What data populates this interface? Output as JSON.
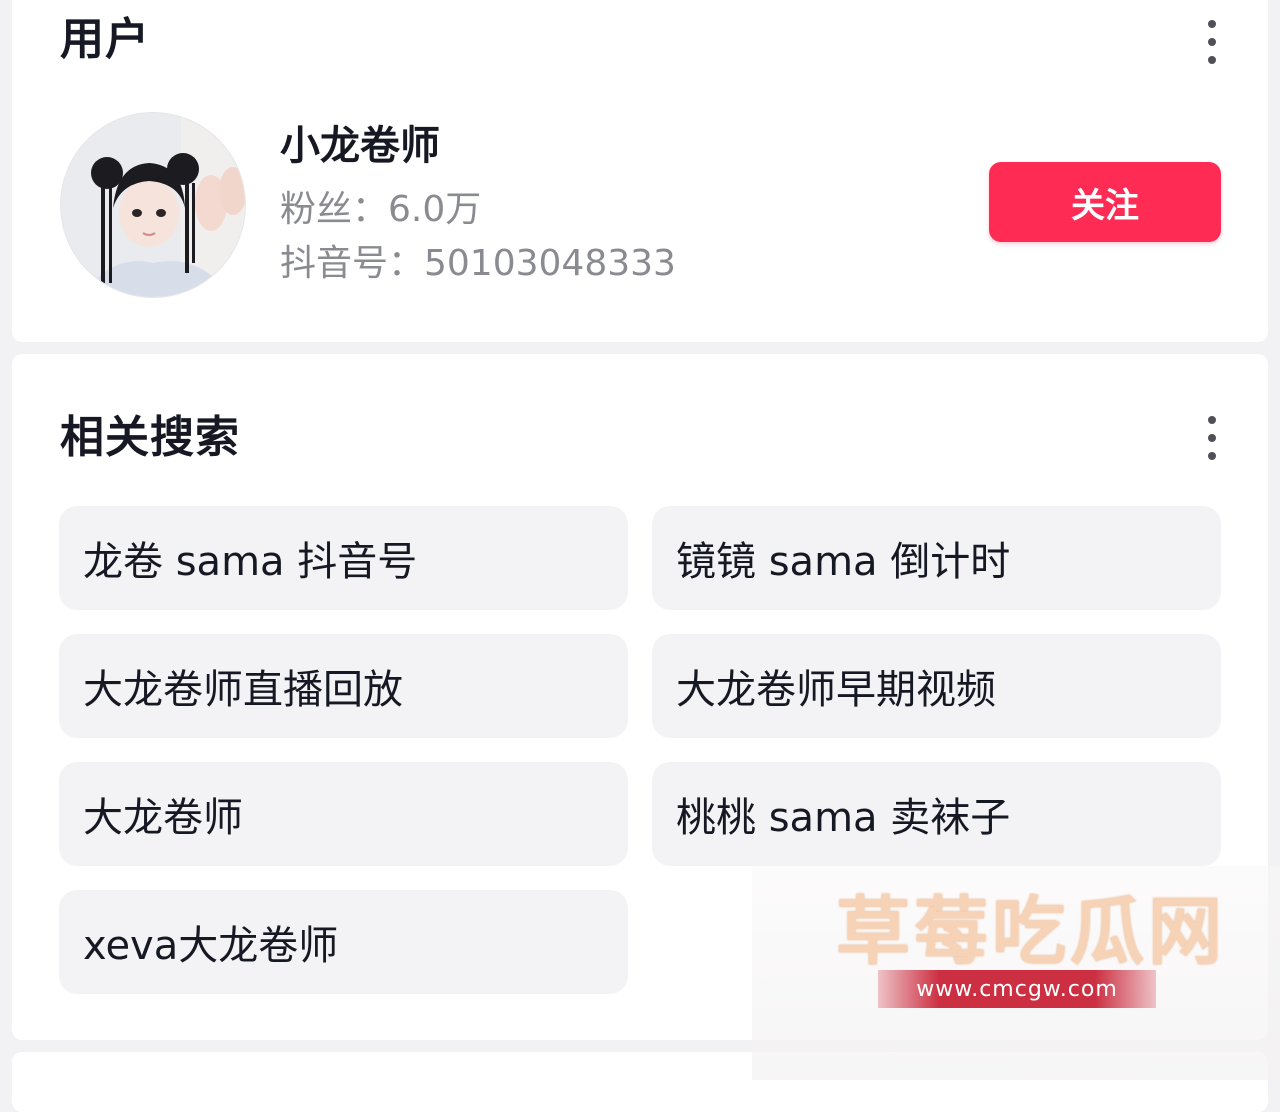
{
  "user_section": {
    "title": "用户",
    "user": {
      "name": "小龙卷师",
      "fans": "粉丝：6.0万",
      "douyin_id": "抖音号：50103048333"
    },
    "follow_label": "关注"
  },
  "related_section": {
    "title": "相关搜索",
    "items": [
      "龙卷 sama 抖音号",
      "镜镜 sama 倒计时",
      "大龙卷师直播回放",
      "大龙卷师早期视频",
      "大龙卷师",
      "桃桃 sama 卖袜子",
      "xeva大龙卷师"
    ]
  },
  "watermark": {
    "title": "草莓吃瓜网",
    "url": "www.cmcgw.com"
  },
  "colors": {
    "accent": "#fe2c55",
    "chip_background": "#f3f3f5",
    "secondary_text": "#8a8b91"
  },
  "icons": [
    "more-vertical-icon",
    "avatar-image"
  ]
}
